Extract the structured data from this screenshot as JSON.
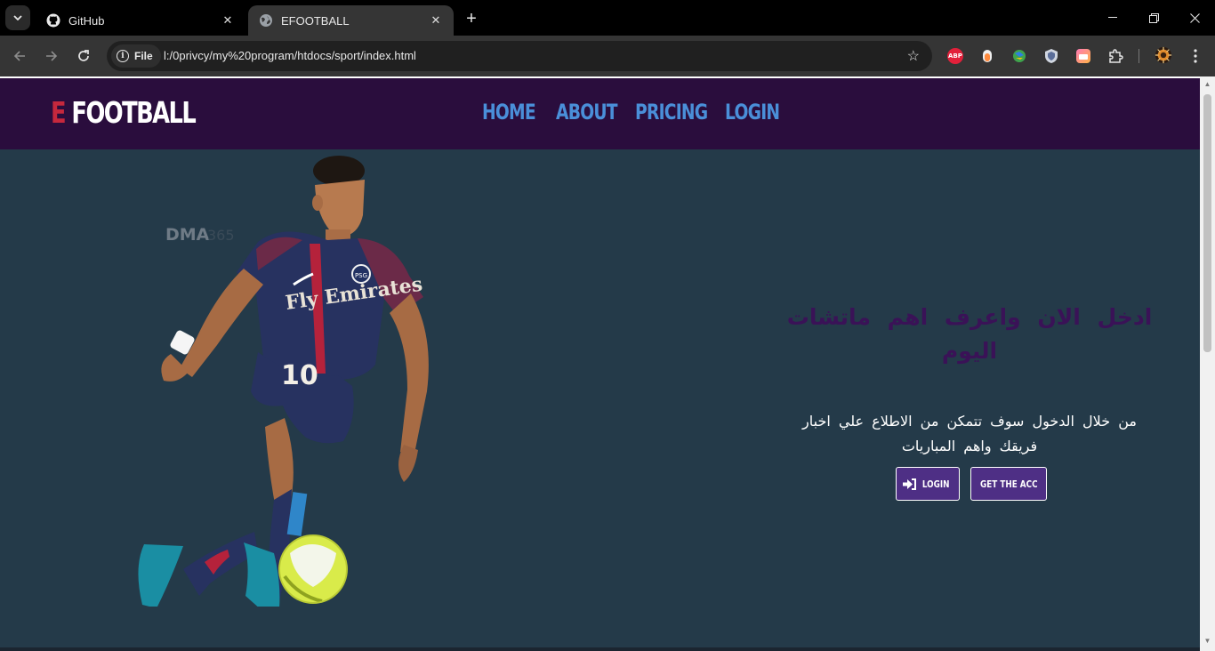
{
  "browser": {
    "tabs": [
      {
        "title": "GitHub",
        "icon": "github-icon",
        "active": false
      },
      {
        "title": "EFOOTBALL",
        "icon": "globe-icon",
        "active": true
      }
    ],
    "address": {
      "chip_label": "File",
      "url": "l:/0privcy/my%20program/htdocs/sport/index.html"
    },
    "extensions": [
      "adblock-plus-icon",
      "extension-orange-icon",
      "extension-globe-icon",
      "shield-extension-icon",
      "extension-gradient-icon",
      "puzzle-icon"
    ]
  },
  "site": {
    "logo": {
      "accent": "E",
      "text": " FOOTBALL"
    },
    "nav": [
      "HOME",
      "ABOUT",
      "PRICING",
      "LOGIN"
    ],
    "watermark": "DMA",
    "jersey_sponsor": "Fly Emirates",
    "jersey_number": "10",
    "hero": {
      "title": "ادخل الان واعرف اهم ماتشات اليوم",
      "description": "من خلال الدخول سوف تتمكن من الاطلاع علي اخبار فريقك واهم المباريات"
    },
    "buttons": {
      "login": "LOGIN",
      "get_acc": "GET THE ACC"
    },
    "colors": {
      "header": "#2a0d3d",
      "body": "#243a49",
      "nav": "#4a8fd9",
      "logo_accent": "#c5283d",
      "button": "#4e2f85"
    }
  }
}
